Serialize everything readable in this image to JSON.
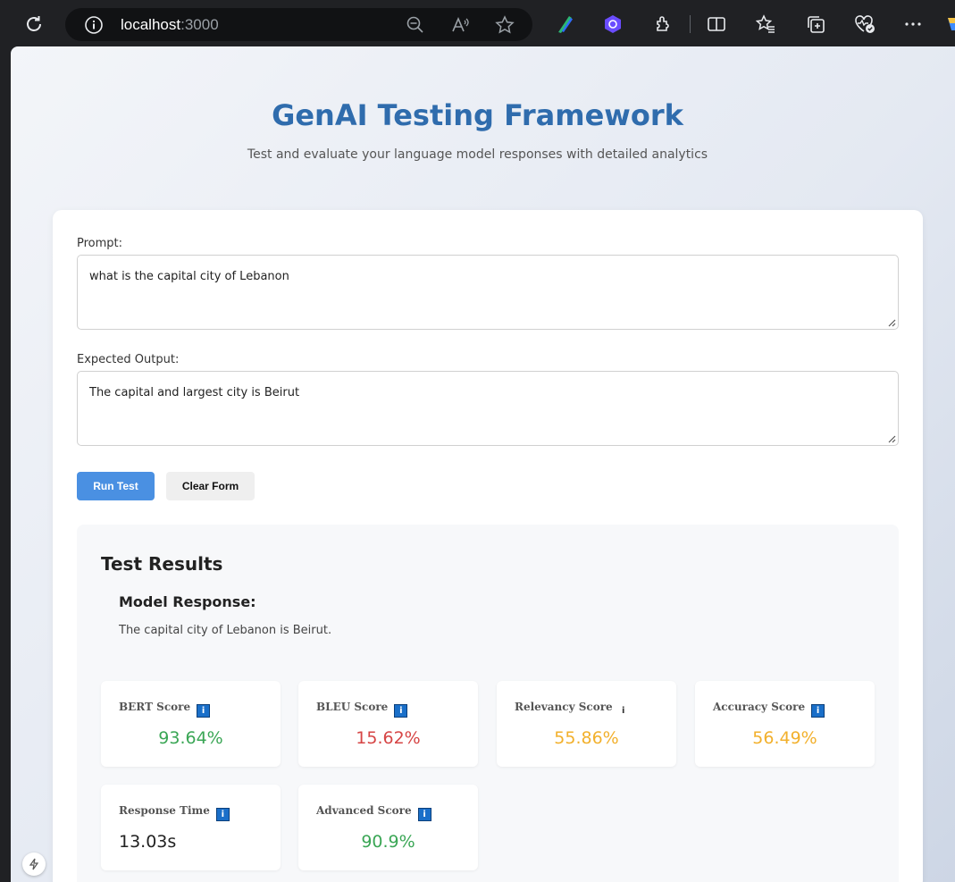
{
  "browser": {
    "host": "localhost",
    "port": ":3000"
  },
  "header": {
    "title": "GenAI Testing Framework",
    "subtitle": "Test and evaluate your language model responses with detailed analytics"
  },
  "form": {
    "prompt_label": "Prompt:",
    "prompt_value": "what is the capital city of Lebanon",
    "expected_label": "Expected Output:",
    "expected_value": "The capital and largest city is Beirut",
    "run_label": "Run Test",
    "clear_label": "Clear Form"
  },
  "results": {
    "title": "Test Results",
    "model_title": "Model Response:",
    "model_text": "The capital city of Lebanon is Beirut.",
    "metrics": [
      {
        "label": "BERT Score",
        "value": "93.64%",
        "info": "i"
      },
      {
        "label": "BLEU Score",
        "value": "15.62%",
        "info": "i"
      },
      {
        "label": "Relevancy Score",
        "value": "55.86%",
        "info": "i"
      },
      {
        "label": "Accuracy Score",
        "value": "56.49%",
        "info": "i"
      },
      {
        "label": "Response Time",
        "value": "13.03s",
        "info": "i"
      },
      {
        "label": "Advanced Score",
        "value": "90.9%",
        "info": "i"
      }
    ]
  },
  "colors": {
    "good": "#3aa655",
    "bad": "#d64545",
    "medium": "#f2b02c",
    "accent": "#4a90e2",
    "title": "#2f6cad"
  }
}
